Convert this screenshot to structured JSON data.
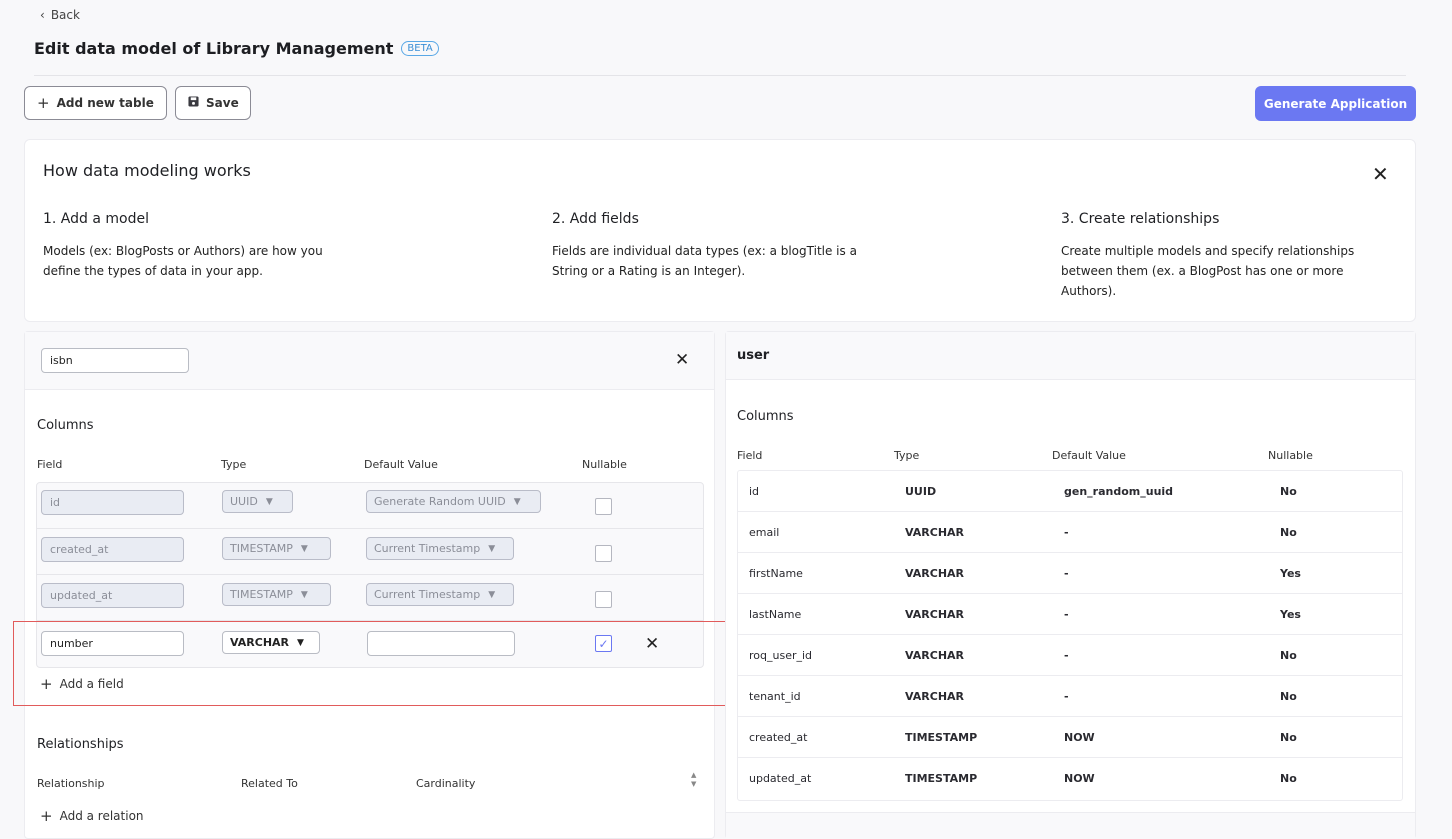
{
  "header": {
    "back_label": "Back",
    "title": "Edit data model of Library Management",
    "badge": "BETA"
  },
  "toolbar": {
    "add_table_label": "Add new table",
    "save_label": "Save",
    "generate_label": "Generate Application"
  },
  "info": {
    "title": "How data modeling works",
    "steps": [
      {
        "heading": "1. Add a model",
        "text": "Models (ex: BlogPosts or Authors) are how you define the types of data in your app."
      },
      {
        "heading": "2. Add fields",
        "text": "Fields are individual data types (ex: a blogTitle is a String or a Rating is an Integer)."
      },
      {
        "heading": "3. Create relationships",
        "text": "Create multiple models and specify relationships between them (ex. a BlogPost has one or more Authors)."
      }
    ]
  },
  "left_table": {
    "name": "isbn",
    "columns_heading": "Columns",
    "headers": {
      "field": "Field",
      "type": "Type",
      "default": "Default Value",
      "nullable": "Nullable"
    },
    "rows": [
      {
        "field": "id",
        "type": "UUID",
        "default": "Generate Random UUID",
        "nullable": false
      },
      {
        "field": "created_at",
        "type": "TIMESTAMP",
        "default": "Current Timestamp",
        "nullable": false
      },
      {
        "field": "updated_at",
        "type": "TIMESTAMP",
        "default": "Current Timestamp",
        "nullable": false
      },
      {
        "field": "number",
        "type": "VARCHAR",
        "default": "",
        "nullable": true
      }
    ],
    "add_field_label": "Add a field",
    "relationships_heading": "Relationships",
    "rel_headers": {
      "relationship": "Relationship",
      "related_to": "Related To",
      "cardinality": "Cardinality"
    },
    "add_relation_label": "Add a relation"
  },
  "right_table": {
    "name": "user",
    "columns_heading": "Columns",
    "headers": {
      "field": "Field",
      "type": "Type",
      "default": "Default Value",
      "nullable": "Nullable"
    },
    "rows": [
      {
        "field": "id",
        "type": "UUID",
        "default": "gen_random_uuid",
        "nullable": "No"
      },
      {
        "field": "email",
        "type": "VARCHAR",
        "default": "-",
        "nullable": "No"
      },
      {
        "field": "firstName",
        "type": "VARCHAR",
        "default": "-",
        "nullable": "Yes"
      },
      {
        "field": "lastName",
        "type": "VARCHAR",
        "default": "-",
        "nullable": "Yes"
      },
      {
        "field": "roq_user_id",
        "type": "VARCHAR",
        "default": "-",
        "nullable": "No"
      },
      {
        "field": "tenant_id",
        "type": "VARCHAR",
        "default": "-",
        "nullable": "No"
      },
      {
        "field": "created_at",
        "type": "TIMESTAMP",
        "default": "NOW",
        "nullable": "No"
      },
      {
        "field": "updated_at",
        "type": "TIMESTAMP",
        "default": "NOW",
        "nullable": "No"
      }
    ]
  },
  "colors": {
    "accent": "#6b78f2",
    "badge": "#3b8fd6",
    "highlight": "#e15b5b"
  }
}
